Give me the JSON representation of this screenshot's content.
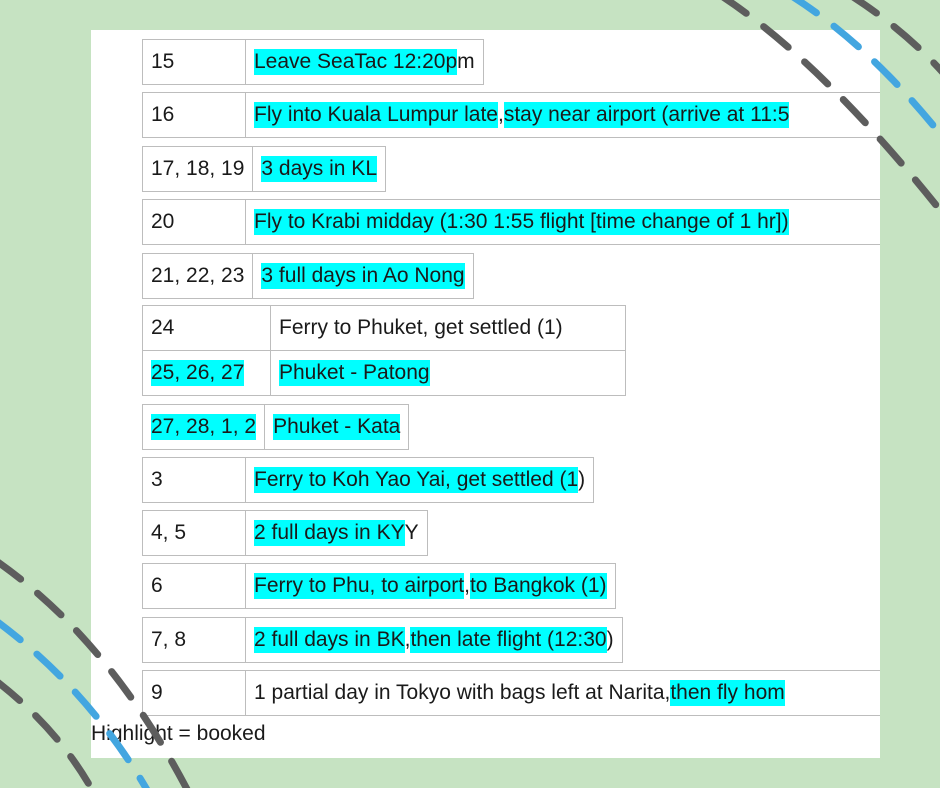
{
  "colors": {
    "background": "#c6e3c2",
    "highlight": "#00ffff",
    "dash_gray": "#5d5d5d",
    "dash_blue": "#43a6e0"
  },
  "rows": [
    {
      "date": "15",
      "parts": [
        {
          "text": "Leave SeaTac 12:20p",
          "hl": true
        },
        {
          "text": "m",
          "hl": false
        }
      ]
    },
    {
      "date": "16",
      "parts": [
        {
          "text": "Fly into Kuala Lumpur late",
          "hl": true
        },
        {
          "text": ", ",
          "hl": false
        },
        {
          "text": "stay near airport (arrive at 11:5",
          "hl": true
        }
      ]
    },
    {
      "date": "17, 18, 19",
      "parts": [
        {
          "text": "3 days in KL",
          "hl": true
        }
      ]
    },
    {
      "date": "20",
      "parts": [
        {
          "text": "Fly to Krabi midday (1:30 1:55 flight [time change of 1 hr])",
          "hl": true
        }
      ]
    },
    {
      "date": "21, 22, 23",
      "parts": [
        {
          "text": "3 full days in Ao Nong",
          "hl": true
        }
      ]
    },
    {
      "date": "24",
      "parts": [
        {
          "text": "Ferry to Phuket, get settled (1)",
          "hl": false
        }
      ]
    },
    {
      "date": "25, 26, 27",
      "date_hl": true,
      "parts": [
        {
          "text": "Phuket - Patong",
          "hl": true
        }
      ]
    },
    {
      "date": "27, 28, 1, 2",
      "date_hl": true,
      "parts": [
        {
          "text": "Phuket - Kata",
          "hl": true
        }
      ]
    },
    {
      "date": "3",
      "parts": [
        {
          "text": "Ferry to Koh Yao Yai, get settled (1",
          "hl": true
        },
        {
          "text": ")",
          "hl": false
        }
      ]
    },
    {
      "date": "4, 5",
      "parts": [
        {
          "text": "2 full days in KY",
          "hl": true
        },
        {
          "text": "Y",
          "hl": false
        }
      ]
    },
    {
      "date": "6",
      "parts": [
        {
          "text": "Ferry to Phu, to airport",
          "hl": true
        },
        {
          "text": ", ",
          "hl": false
        },
        {
          "text": "to Bangkok (1)",
          "hl": true
        }
      ]
    },
    {
      "date": "7, 8",
      "parts": [
        {
          "text": "2 full days in BK",
          "hl": true
        },
        {
          "text": ", ",
          "hl": false
        },
        {
          "text": "then late flight (12:30",
          "hl": true
        },
        {
          "text": ")",
          "hl": false
        }
      ]
    },
    {
      "date": "9",
      "parts": [
        {
          "text": "1 partial day in Tokyo with bags left at Narita, ",
          "hl": false
        },
        {
          "text": "then fly hom",
          "hl": true
        }
      ]
    }
  ],
  "legend": "Highlight = booked"
}
